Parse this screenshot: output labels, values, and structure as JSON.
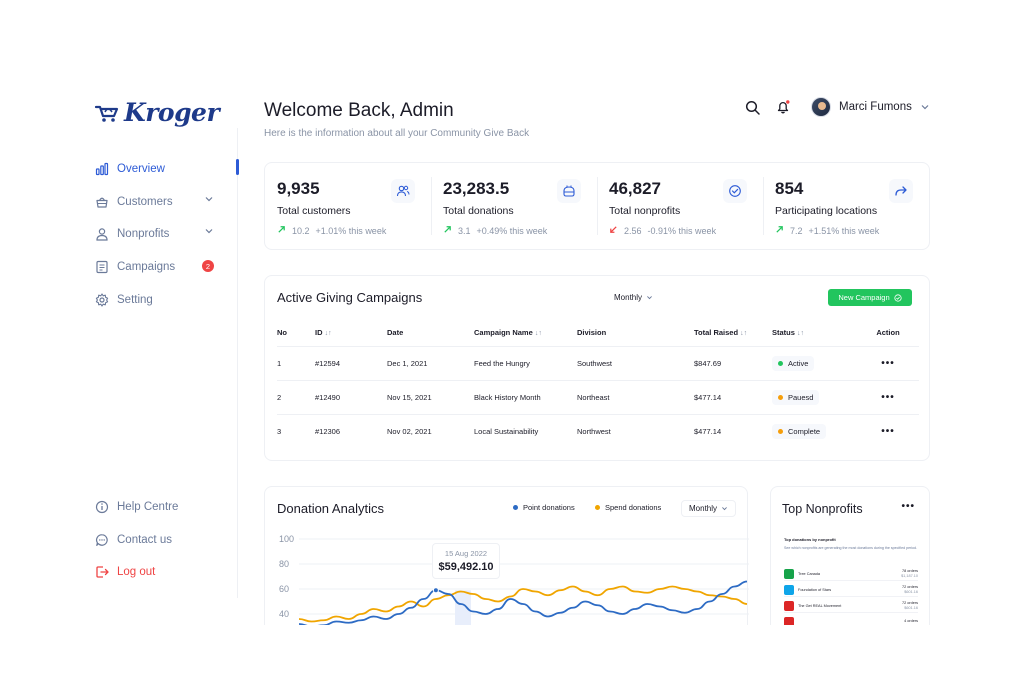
{
  "brand": {
    "name": "Kroger",
    "color": "#1e3a8a"
  },
  "sidebar": {
    "items": [
      {
        "label": "Overview",
        "icon": "bar-chart-icon",
        "active": true
      },
      {
        "label": "Customers",
        "icon": "basket-icon",
        "chevron": true
      },
      {
        "label": "Nonprofits",
        "icon": "user-icon",
        "chevron": true
      },
      {
        "label": "Campaigns",
        "icon": "document-icon",
        "badge": "2"
      },
      {
        "label": "Setting",
        "icon": "gear-icon"
      }
    ],
    "footer": [
      {
        "label": "Help Centre",
        "icon": "info-icon"
      },
      {
        "label": "Contact us",
        "icon": "chat-icon"
      },
      {
        "label": "Log out",
        "icon": "logout-icon"
      }
    ]
  },
  "header": {
    "title": "Welcome Back, Admin",
    "subtitle": "Here is the information about all your Community Give Back",
    "user_name": "Marci Fumons"
  },
  "stats": [
    {
      "value": "9,935",
      "label": "Total customers",
      "trend_value": "10.2",
      "trend_text": "+1.01% this week",
      "direction": "up",
      "icon": "users-icon"
    },
    {
      "value": "23,283.5",
      "label": "Total donations",
      "trend_value": "3.1",
      "trend_text": "+0.49% this week",
      "direction": "up",
      "icon": "donation-icon"
    },
    {
      "value": "46,827",
      "label": "Total nonprofits",
      "trend_value": "2.56",
      "trend_text": "-0.91% this week",
      "direction": "down",
      "icon": "check-circle-icon"
    },
    {
      "value": "854",
      "label": "Participating locations",
      "trend_value": "7.2",
      "trend_text": "+1.51% this week",
      "direction": "up",
      "icon": "arrow-right-icon"
    }
  ],
  "campaigns": {
    "title": "Active Giving Campaigns",
    "period": "Monthly",
    "new_label": "New Campaign",
    "columns": [
      "No",
      "ID",
      "Date",
      "Campaign Name",
      "Division",
      "Total Raised",
      "Status",
      "Action"
    ],
    "rows": [
      {
        "no": "1",
        "id": "#12594",
        "date": "Dec 1, 2021",
        "name": "Feed the Hungry",
        "division": "Southwest",
        "raised": "$847.69",
        "status": "Active",
        "status_color": "#22c55e"
      },
      {
        "no": "2",
        "id": "#12490",
        "date": "Nov 15, 2021",
        "name": "Black History Month",
        "division": "Northeast",
        "raised": "$477.14",
        "status": "Pauesd",
        "status_color": "#f59e0b"
      },
      {
        "no": "3",
        "id": "#12306",
        "date": "Nov 02, 2021",
        "name": "Local Sustainability",
        "division": "Northwest",
        "raised": "$477.14",
        "status": "Complete",
        "status_color": "#f59e0b"
      }
    ]
  },
  "analytics": {
    "title": "Donation Analytics",
    "legend": [
      {
        "label": "Point donations",
        "color": "#2d6bc4"
      },
      {
        "label": "Spend donations",
        "color": "#f0a500"
      }
    ],
    "period": "Monthly",
    "y_ticks": [
      "100",
      "80",
      "60",
      "40"
    ],
    "tooltip_date": "15 Aug 2022",
    "tooltip_value": "$59,492.10"
  },
  "chart_data": {
    "type": "line",
    "ylim": [
      30,
      100
    ],
    "series": [
      {
        "name": "Point donations",
        "values": [
          32,
          30,
          31,
          34,
          33,
          35,
          38,
          36,
          40,
          45,
          52,
          59,
          56,
          48,
          42,
          40,
          44,
          52,
          48,
          42,
          38,
          41,
          45,
          50,
          47,
          42,
          40,
          44,
          48,
          46,
          43,
          41,
          44,
          50,
          56,
          62,
          66
        ]
      },
      {
        "name": "Spend donations",
        "values": [
          36,
          34,
          35,
          38,
          36,
          40,
          44,
          42,
          46,
          50,
          46,
          52,
          55,
          58,
          56,
          52,
          50,
          54,
          60,
          58,
          55,
          59,
          62,
          58,
          55,
          60,
          62,
          58,
          57,
          60,
          62,
          60,
          58,
          55,
          54,
          52,
          48
        ]
      }
    ]
  },
  "top_nonprofits": {
    "title": "Top Nonprofits",
    "mini_title": "Top donations by nonprofit",
    "mini_sub": "See which nonprofits are generating the most donations during the specified period.",
    "rows": [
      {
        "name": "Tree Canada",
        "orders": "78 orders",
        "amount": "$1,187.10",
        "color": "#16a34a"
      },
      {
        "name": "Foundation of Stars",
        "orders": "72 orders",
        "amount": "$601.16",
        "color": "#0ea5e9"
      },
      {
        "name": "The Get REAL Movement",
        "orders": "72 orders",
        "amount": "$601.16",
        "color": "#dc2626"
      },
      {
        "name": "",
        "orders": "4 orders",
        "amount": "",
        "color": "#dc2626"
      }
    ]
  }
}
